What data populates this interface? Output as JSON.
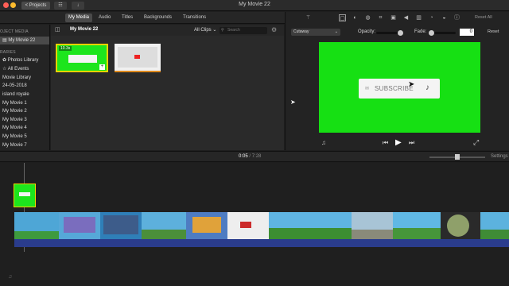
{
  "titlebar": {
    "projects_label": "< Projects",
    "window_title": "My Movie 22"
  },
  "tabs": [
    "My Media",
    "Audio",
    "Titles",
    "Backgrounds",
    "Transitions"
  ],
  "sidebar": {
    "project_media_header": "OJECT MEDIA",
    "project_item": "My Movie 22",
    "libraries_header": "RARIES",
    "items": [
      "Photos Library",
      "All Events",
      "Movie Library",
      "24-05-2018",
      "island royale",
      "My Movie 1",
      "My Movie 2",
      "My Movie 3",
      "My Movie 4",
      "My Movie 5",
      "My Movie 7"
    ]
  },
  "browser": {
    "title": "My Movie 22",
    "filter": "All Clips",
    "search_placeholder": "Search",
    "clip1_duration": "10.3s"
  },
  "inspector": {
    "reset_all": "Reset All",
    "mode": "Cutaway",
    "opacity_label": "Opacity:",
    "fade_label": "Fade:",
    "fade_value": "0",
    "reset_label": "Reset"
  },
  "viewer": {
    "subscribe_text": "SUBSCRIBE"
  },
  "timeline": {
    "current_time": "0:05",
    "separator": "/",
    "total_time": "7:28",
    "settings_label": "Settings"
  },
  "colors": {
    "green_screen": "#16e013",
    "clip_selected_border": "#f2d200",
    "audio_track": "#2a3c8c"
  }
}
